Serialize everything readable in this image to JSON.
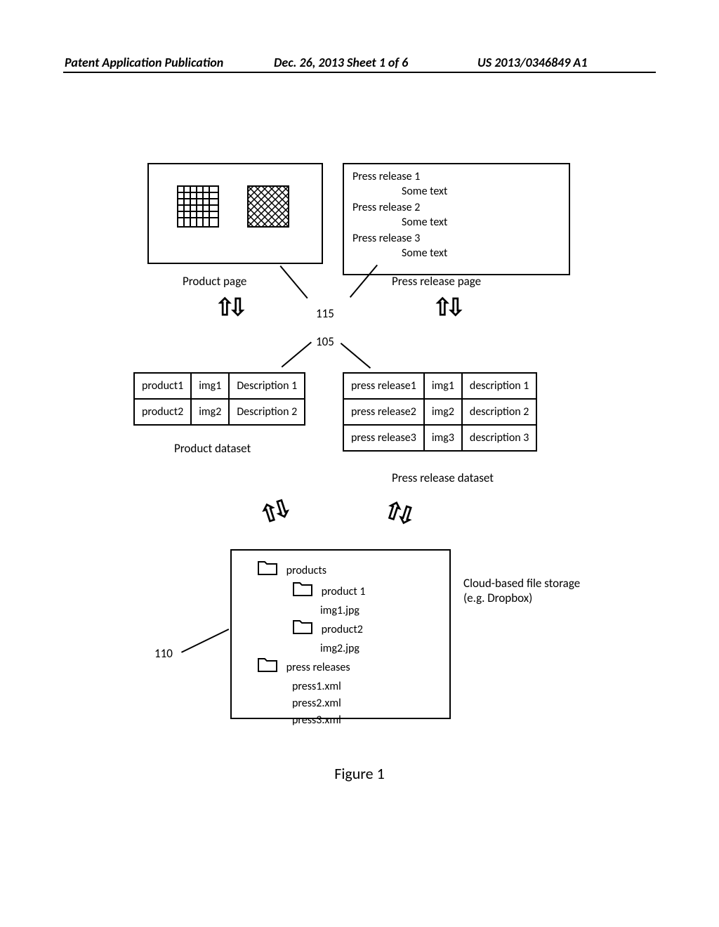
{
  "header": {
    "left": "Patent Application Publication",
    "center": "Dec. 26, 2013  Sheet 1 of 6",
    "right": "US 2013/0346849 A1"
  },
  "product_page": {
    "label": "Product page"
  },
  "press_page": {
    "label": "Press release page",
    "items": [
      {
        "title": "Press release 1",
        "text": "Some text"
      },
      {
        "title": "Press release 2",
        "text": "Some text"
      },
      {
        "title": "Press release 3",
        "text": "Some text"
      }
    ]
  },
  "refs": {
    "r115": "115",
    "r105": "105",
    "r110": "110"
  },
  "product_dataset": {
    "label": "Product dataset",
    "rows": [
      [
        "product1",
        "img1",
        "Description 1"
      ],
      [
        "product2",
        "img2",
        "Description 2"
      ]
    ]
  },
  "press_dataset": {
    "label": "Press release dataset",
    "rows": [
      [
        "press release1",
        "img1",
        "description 1"
      ],
      [
        "press release2",
        "img2",
        "description 2"
      ],
      [
        "press release3",
        "img3",
        "description 3"
      ]
    ]
  },
  "storage": {
    "label": "Cloud-based file storage (e.g. Dropbox)",
    "tree": {
      "products": {
        "label": "products",
        "children": [
          {
            "folder": "product 1",
            "file": "img1.jpg"
          },
          {
            "folder": "product2",
            "file": "img2.jpg"
          }
        ]
      },
      "press": {
        "label": "press releases",
        "files": [
          "press1.xml",
          "press2.xml",
          "press3.xml"
        ]
      }
    }
  },
  "figure": "Figure 1"
}
